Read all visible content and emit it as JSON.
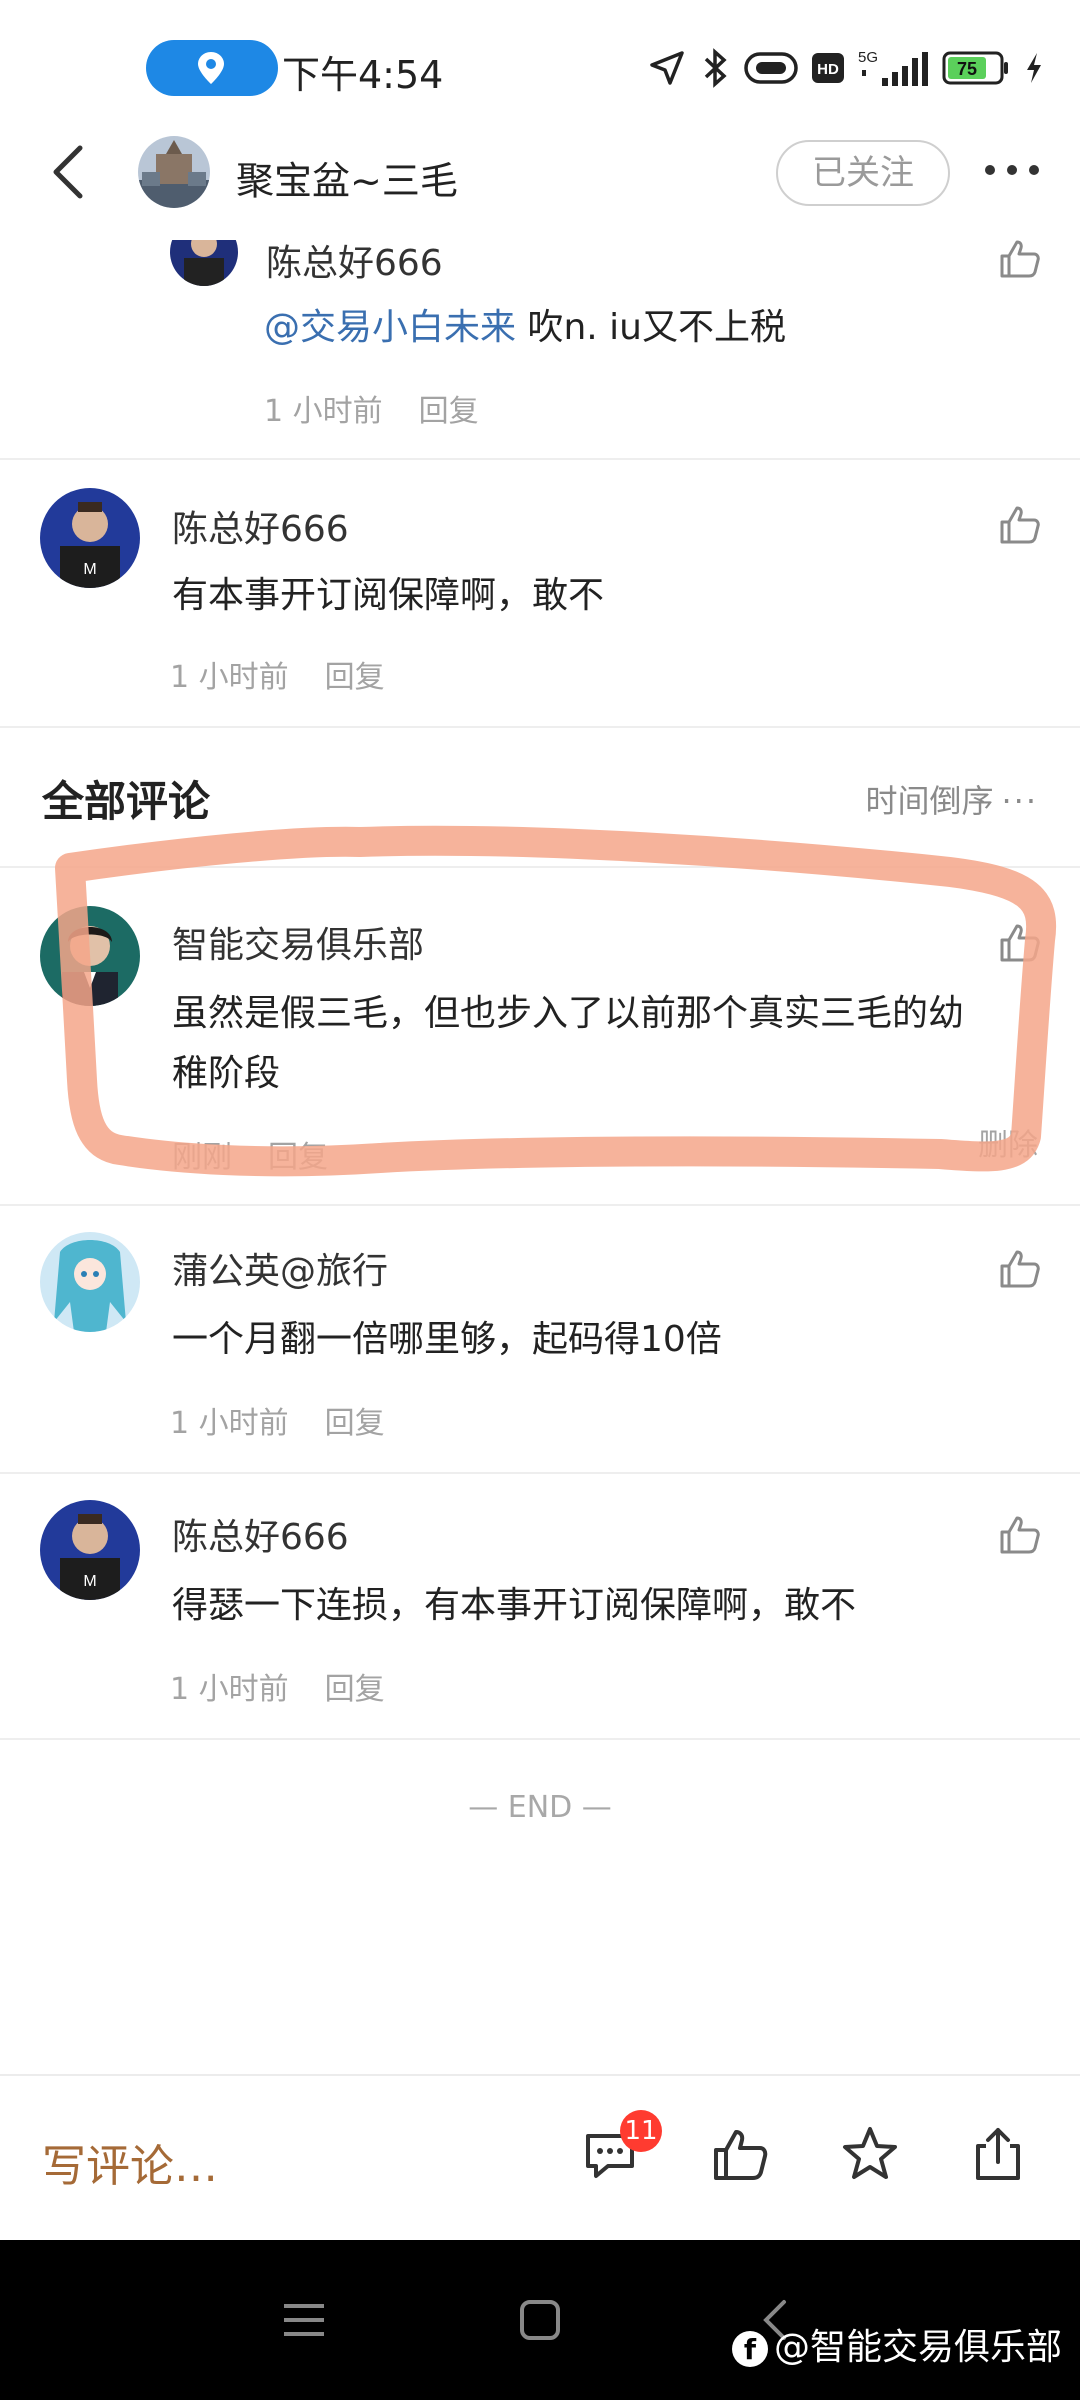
{
  "status_bar": {
    "time": "下午4:54",
    "network": "5G",
    "hd": "HD",
    "battery": "75",
    "icons": [
      "location-icon",
      "navigation-arrow-icon",
      "bluetooth-icon",
      "vibrate-icon",
      "hd-icon",
      "signal-icon",
      "battery-icon",
      "charging-icon"
    ]
  },
  "header": {
    "title": "聚宝盆~三毛",
    "follow_label": "已关注",
    "icons": [
      "back-icon",
      "more-icon"
    ]
  },
  "reply_thread": {
    "name": "陈总好666",
    "mention": "@交易小白未来",
    "text": " 吹n. iu又不上税",
    "time": "1 小时前",
    "reply": "回复"
  },
  "hot_comment": {
    "name": "陈总好666",
    "text": "有本事开订阅保障啊，敢不",
    "time": "1 小时前",
    "reply": "回复"
  },
  "section": {
    "title": "全部评论",
    "sort": "时间倒序",
    "sort_more": "···"
  },
  "comments": [
    {
      "name": "智能交易俱乐部",
      "text_line1": "虽然是假三毛，但也步入了以前那个真实三毛的幼",
      "text_line2": "稚阶段",
      "time": "刚刚",
      "reply": "回复",
      "delete": "删除"
    },
    {
      "name": "蒲公英@旅行",
      "text": "一个月翻一倍哪里够，起码得10倍",
      "time": "1 小时前",
      "reply": "回复"
    },
    {
      "name": "陈总好666",
      "text": "得瑟一下连损，有本事开订阅保障啊，敢不",
      "time": "1 小时前",
      "reply": "回复"
    }
  ],
  "end_text": "— END —",
  "bottom_bar": {
    "write_placeholder": "写评论…",
    "comment_count": "11",
    "icons": [
      "comment-icon",
      "like-icon",
      "star-icon",
      "share-icon"
    ]
  },
  "nav_bar": {
    "icons": [
      "menu-icon",
      "home-icon",
      "back-nav-icon"
    ]
  },
  "watermark": {
    "logo": "f",
    "text": "@智能交易俱乐部"
  },
  "colors": {
    "accent_blue": "#1e88e5",
    "mention": "#3a6fb0",
    "write_text": "#a56a37",
    "badge": "#ff3b30",
    "annotation": "#f5a68a"
  }
}
